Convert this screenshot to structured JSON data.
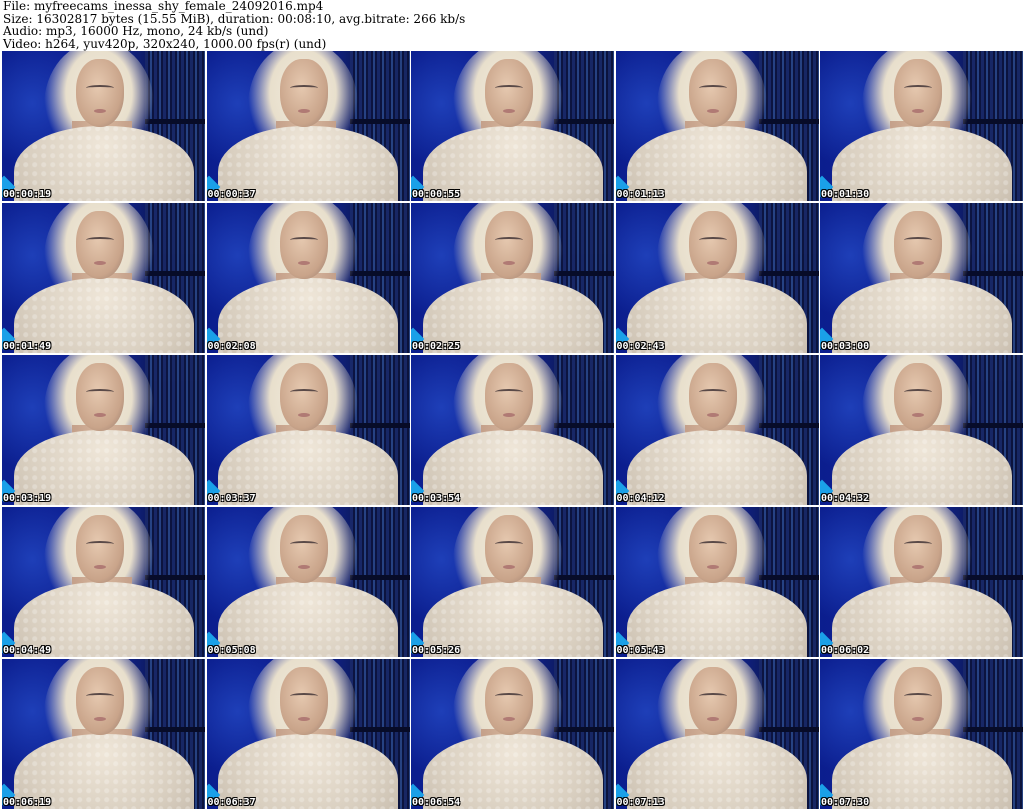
{
  "header": {
    "file_line": "File: myfreecams_inessa_shy_female_24092016.mp4",
    "size_line": "Size: 16302817 bytes (15.55 MiB), duration: 00:08:10, avg.bitrate: 266 kb/s",
    "audio_line": "Audio: mp3, 16000 Hz, mono, 24 kb/s (und)",
    "video_line": "Video: h264, yuv420p, 320x240, 1000.00 fps(r) (und)"
  },
  "thumbnails": [
    {
      "timestamp": "00:00:19"
    },
    {
      "timestamp": "00:00:37"
    },
    {
      "timestamp": "00:00:55"
    },
    {
      "timestamp": "00:01:13"
    },
    {
      "timestamp": "00:01:30"
    },
    {
      "timestamp": "00:01:49"
    },
    {
      "timestamp": "00:02:08"
    },
    {
      "timestamp": "00:02:25"
    },
    {
      "timestamp": "00:02:43"
    },
    {
      "timestamp": "00:03:00"
    },
    {
      "timestamp": "00:03:19"
    },
    {
      "timestamp": "00:03:37"
    },
    {
      "timestamp": "00:03:54"
    },
    {
      "timestamp": "00:04:12"
    },
    {
      "timestamp": "00:04:32"
    },
    {
      "timestamp": "00:04:49"
    },
    {
      "timestamp": "00:05:08"
    },
    {
      "timestamp": "00:05:26"
    },
    {
      "timestamp": "00:05:43"
    },
    {
      "timestamp": "00:06:02"
    },
    {
      "timestamp": "00:06:19"
    },
    {
      "timestamp": "00:06:37"
    },
    {
      "timestamp": "00:06:54"
    },
    {
      "timestamp": "00:07:13"
    },
    {
      "timestamp": "00:07:30"
    }
  ]
}
